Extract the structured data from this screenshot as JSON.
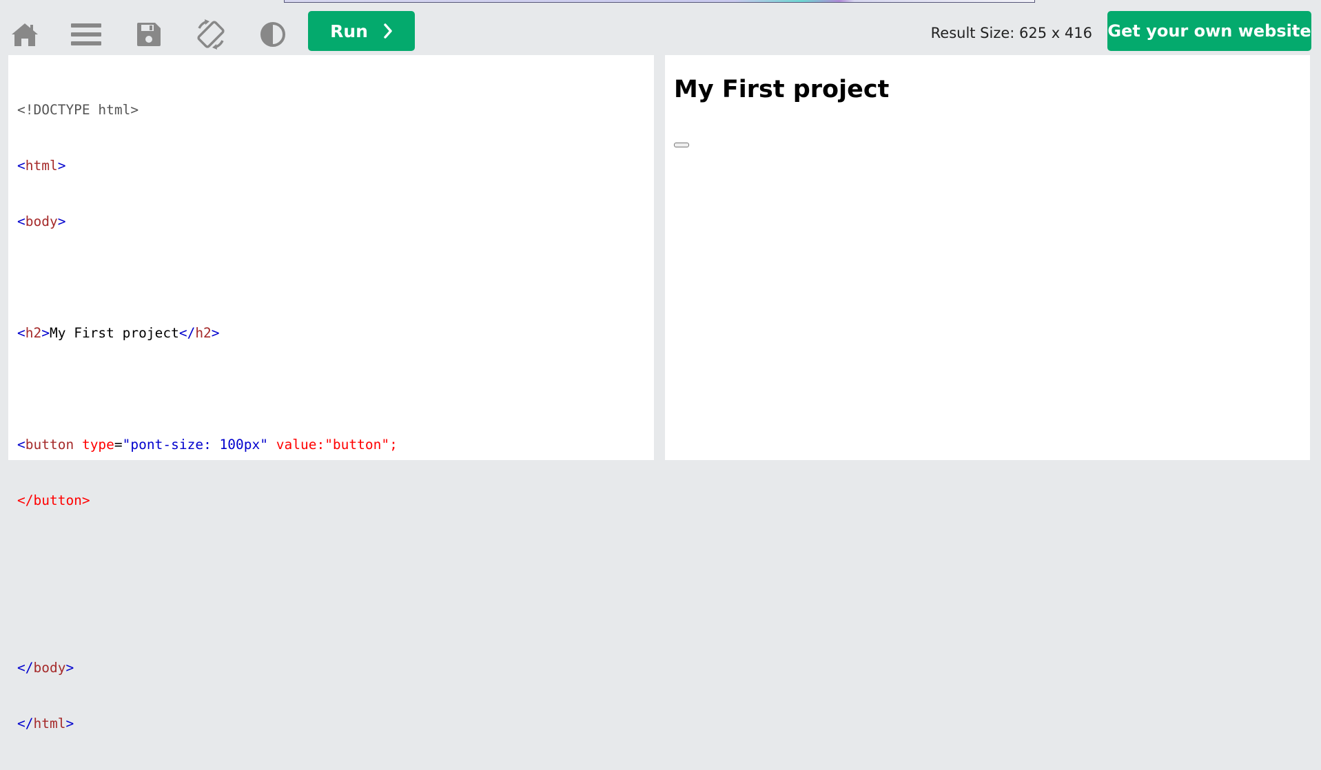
{
  "toolbar": {
    "icons": [
      "home-icon",
      "menu-icon",
      "save-icon",
      "rotate-icon",
      "contrast-icon"
    ],
    "run_label": "Run",
    "result_size_label": "Result Size: 625 x 416",
    "get_website_label": "Get your own website",
    "accent_color": "#04aa6d"
  },
  "editor": {
    "lines": [
      "<!DOCTYPE html>",
      "<html>",
      "<body>",
      "",
      "<h2>My First project</h2>",
      "",
      "<button type=\"pont-size: 100px\" value:\"button\";",
      "</button>",
      "",
      "",
      "</body>",
      "</html>"
    ]
  },
  "result": {
    "heading": "My First project",
    "button_label": ""
  }
}
